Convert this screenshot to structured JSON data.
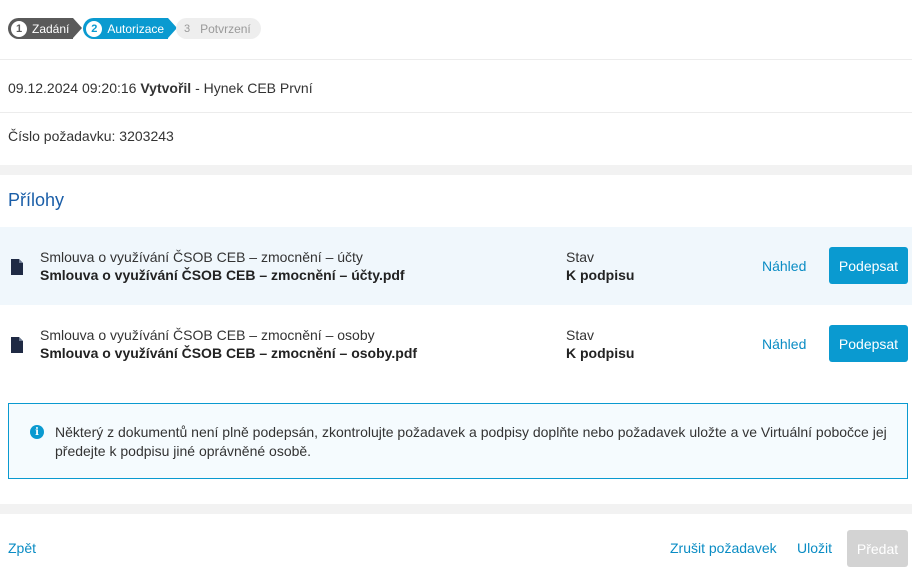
{
  "stepper": {
    "steps": [
      {
        "number": "1",
        "label": "Zadání",
        "state": "done"
      },
      {
        "number": "2",
        "label": "Autorizace",
        "state": "active"
      },
      {
        "number": "3",
        "label": "Potvrzení",
        "state": "pending"
      }
    ]
  },
  "request": {
    "datetime": "09.12.2024 09:20:16",
    "created_label": "Vytvořil",
    "creator_separator": " - ",
    "creator": "Hynek CEB První",
    "number_label": "Číslo požadavku:",
    "number": "3203243"
  },
  "attachments": {
    "title": "Přílohy",
    "items": [
      {
        "name": "Smlouva o využívání ČSOB CEB – zmocnění – účty",
        "file": "Smlouva o využívání ČSOB CEB – zmocnění – účty.pdf",
        "status_label": "Stav",
        "status_value": "K podpisu",
        "preview_label": "Náhled",
        "sign_label": "Podepsat"
      },
      {
        "name": "Smlouva o využívání ČSOB CEB – zmocnění – osoby",
        "file": "Smlouva o využívání ČSOB CEB – zmocnění – osoby.pdf",
        "status_label": "Stav",
        "status_value": "K podpisu",
        "preview_label": "Náhled",
        "sign_label": "Podepsat"
      }
    ]
  },
  "info": {
    "icon": "info-icon",
    "text": "Některý z dokumentů není plně podepsán, zkontrolujte požadavek a podpisy doplňte nebo požadavek uložte a ve Virtuální pobočce jej předejte k podpisu jiné oprávněné osobě."
  },
  "footer": {
    "back_label": "Zpět",
    "cancel_label": "Zrušit požadavek",
    "save_label": "Uložit",
    "submit_label": "Předat"
  },
  "colors": {
    "accent": "#0a9ad0",
    "title": "#1a5ea8",
    "link": "#0a8cc4",
    "disabled": "#d3d3d3"
  }
}
